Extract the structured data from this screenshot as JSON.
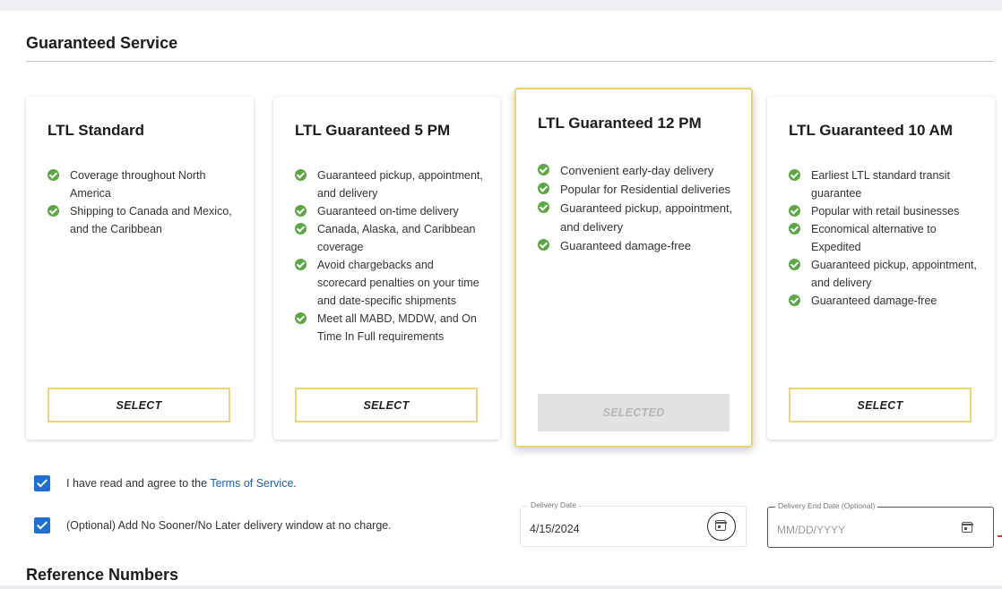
{
  "section": {
    "title": "Guaranteed Service"
  },
  "cards": [
    {
      "title": "LTL Standard",
      "features": [
        "Coverage throughout North America",
        "Shipping to Canada and Mexico, and the Caribbean"
      ],
      "button": "SELECT"
    },
    {
      "title": "LTL Guaranteed 5 PM",
      "features": [
        "Guaranteed pickup, appointment, and delivery",
        "Guaranteed on-time delivery",
        "Canada, Alaska, and Caribbean coverage",
        "Avoid chargebacks and scorecard penalties on your time and date-specific shipments",
        "Meet all MABD, MDDW, and On Time In Full requirements"
      ],
      "button": "SELECT"
    },
    {
      "title": "LTL Guaranteed 12 PM",
      "features": [
        "Convenient early-day delivery",
        "Popular for Residential deliveries",
        "Guaranteed pickup, appointment, and delivery",
        "Guaranteed damage-free"
      ],
      "button": "SELECTED"
    },
    {
      "title": "LTL Guaranteed 10 AM",
      "features": [
        "Earliest LTL standard transit guarantee",
        "Popular with retail businesses",
        "Economical alternative to Expedited",
        "Guaranteed pickup, appointment, and delivery",
        "Guaranteed damage-free"
      ],
      "button": "SELECT"
    }
  ],
  "terms": {
    "text": "I have read and agree to the ",
    "link": "Terms of Service",
    "suffix": "."
  },
  "window_option": {
    "text": "(Optional) Add No Sooner/No Later delivery window at no charge."
  },
  "delivery_date": {
    "label": "Delivery Date",
    "value": "4/15/2024"
  },
  "delivery_end_date": {
    "label": "Delivery End Date (Optional)",
    "placeholder": "MM/DD/YYYY"
  },
  "reference": {
    "title": "Reference Numbers"
  },
  "colors": {
    "accent_border": "#ead57a",
    "check_green": "#5da646",
    "checkbox_blue": "#1f6fd1",
    "link_blue": "#1f5fa8"
  },
  "icons": {
    "feature": "check-circle-icon",
    "calendar": "calendar-icon"
  }
}
